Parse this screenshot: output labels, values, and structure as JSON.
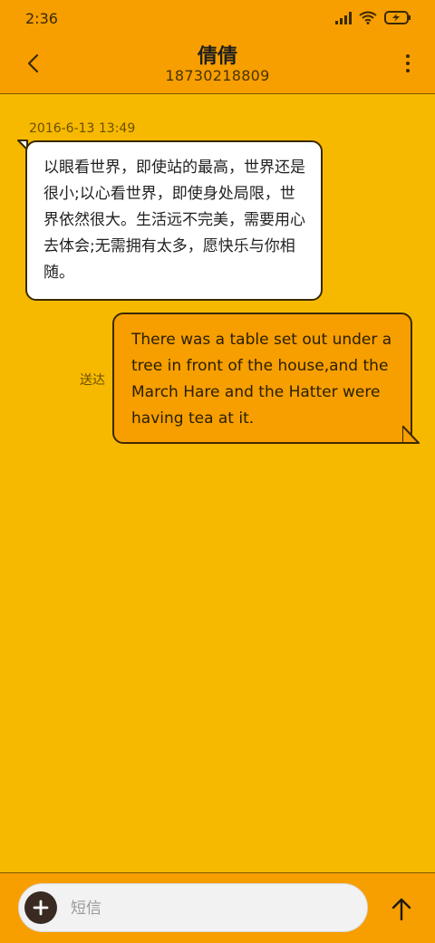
{
  "status_bar": {
    "time": "2:36"
  },
  "header": {
    "contact_name": "倩倩",
    "phone_number": "18730218809"
  },
  "conversation": {
    "timestamp": "2016-6-13 13:49",
    "incoming_message": "以眼看世界，即使站的最高，世界还是很小;以心看世界，即使身处局限，世界依然很大。生活远不完美，需要用心去体会;无需拥有太多，愿快乐与你相随。",
    "outgoing_message": "There was a table set out under a tree in front of the house,and the March Hare and the Hatter were having tea at it.",
    "outgoing_status": "送达"
  },
  "composer": {
    "placeholder": "短信"
  },
  "colors": {
    "background": "#F7B900",
    "header_bar": "#F79E00",
    "incoming_bubble": "#FFFFFF",
    "outgoing_bubble": "#F79E00"
  },
  "icons": [
    "back-chevron-icon",
    "more-vertical-icon",
    "signal-icon",
    "wifi-icon",
    "battery-charging-icon",
    "plus-icon",
    "send-arrow-icon"
  ]
}
